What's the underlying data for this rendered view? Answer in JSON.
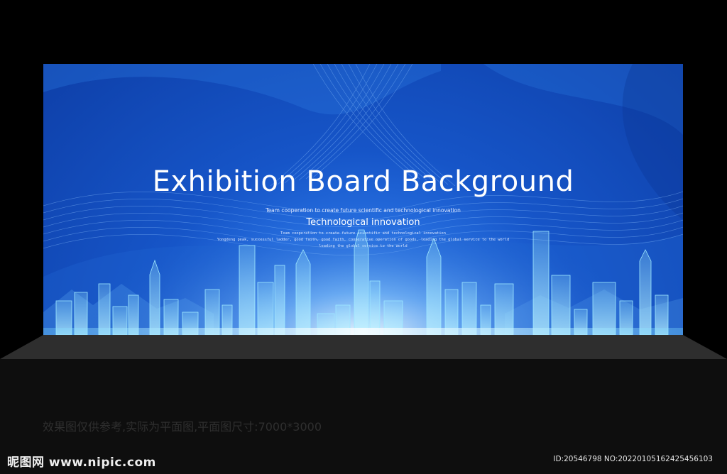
{
  "board": {
    "title": "Exhibition Board Background",
    "subtitle_small": "Team cooperation to create future scientific and technological innovation",
    "subtitle": "Technological innovation",
    "lines": [
      "Team cooperation to create future scientific and technological innovation",
      "Yongdeng peak, successful ladder, good faith, good faith, cooperative operation of goods, leading the global service to the world",
      "leading the global service to the world"
    ],
    "colors": {
      "deep": "#0e3fa8",
      "mid": "#1655c8",
      "glow": "#6ab8ff",
      "skyline": "#7fe0ff"
    }
  },
  "footer": {
    "note": "效果图仅供参考,实际为平面图,平面图尺寸:7000*3000",
    "logo": "昵图网 www.nipic.com",
    "id": "ID:20546798 NO:20220105162425456103"
  }
}
